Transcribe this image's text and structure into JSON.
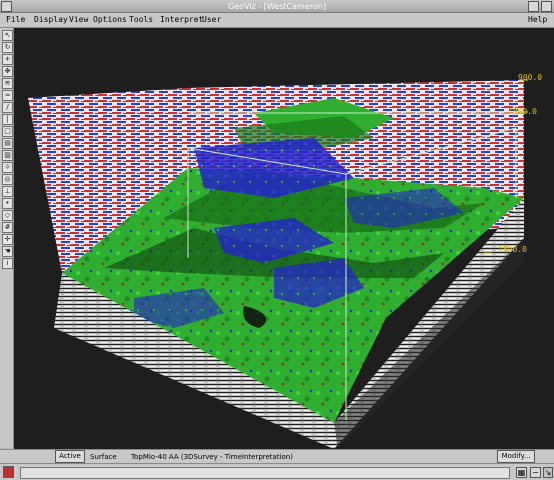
{
  "window": {
    "title": "GeoViz - [WestCameron]"
  },
  "menu": {
    "file": "File",
    "display": "Display",
    "view": "View",
    "options": "Options",
    "tools": "Tools",
    "interpret": "Interpret",
    "user": "User",
    "help": "Help"
  },
  "toolbar": {
    "tools": [
      "pointer",
      "rotate",
      "zoom",
      "pan",
      "seismic",
      "horizon",
      "fault",
      "well",
      "cube",
      "colormap",
      "slice",
      "light",
      "camera",
      "measure",
      "pick",
      "snap",
      "grid",
      "move",
      "hand",
      "info"
    ]
  },
  "viewport": {
    "axis_labels": {
      "t900": "900.0",
      "t1000": "1000.0",
      "t1500": "1500.0"
    },
    "colors": {
      "background": "#1e1e1e",
      "seismic_red": "#d03030",
      "seismic_blue": "#2040e0",
      "horizon_green": "#30c030",
      "horizon_blue": "#2020d0",
      "axis_text": "#e0c000",
      "bounding_box": "#c8f0c8"
    }
  },
  "status": {
    "active_button": "Active",
    "object_type": "Surface",
    "description": "TopMio-40 AA (3DSurvey - TimeInterpretation)",
    "modify_button": "Modify..."
  }
}
